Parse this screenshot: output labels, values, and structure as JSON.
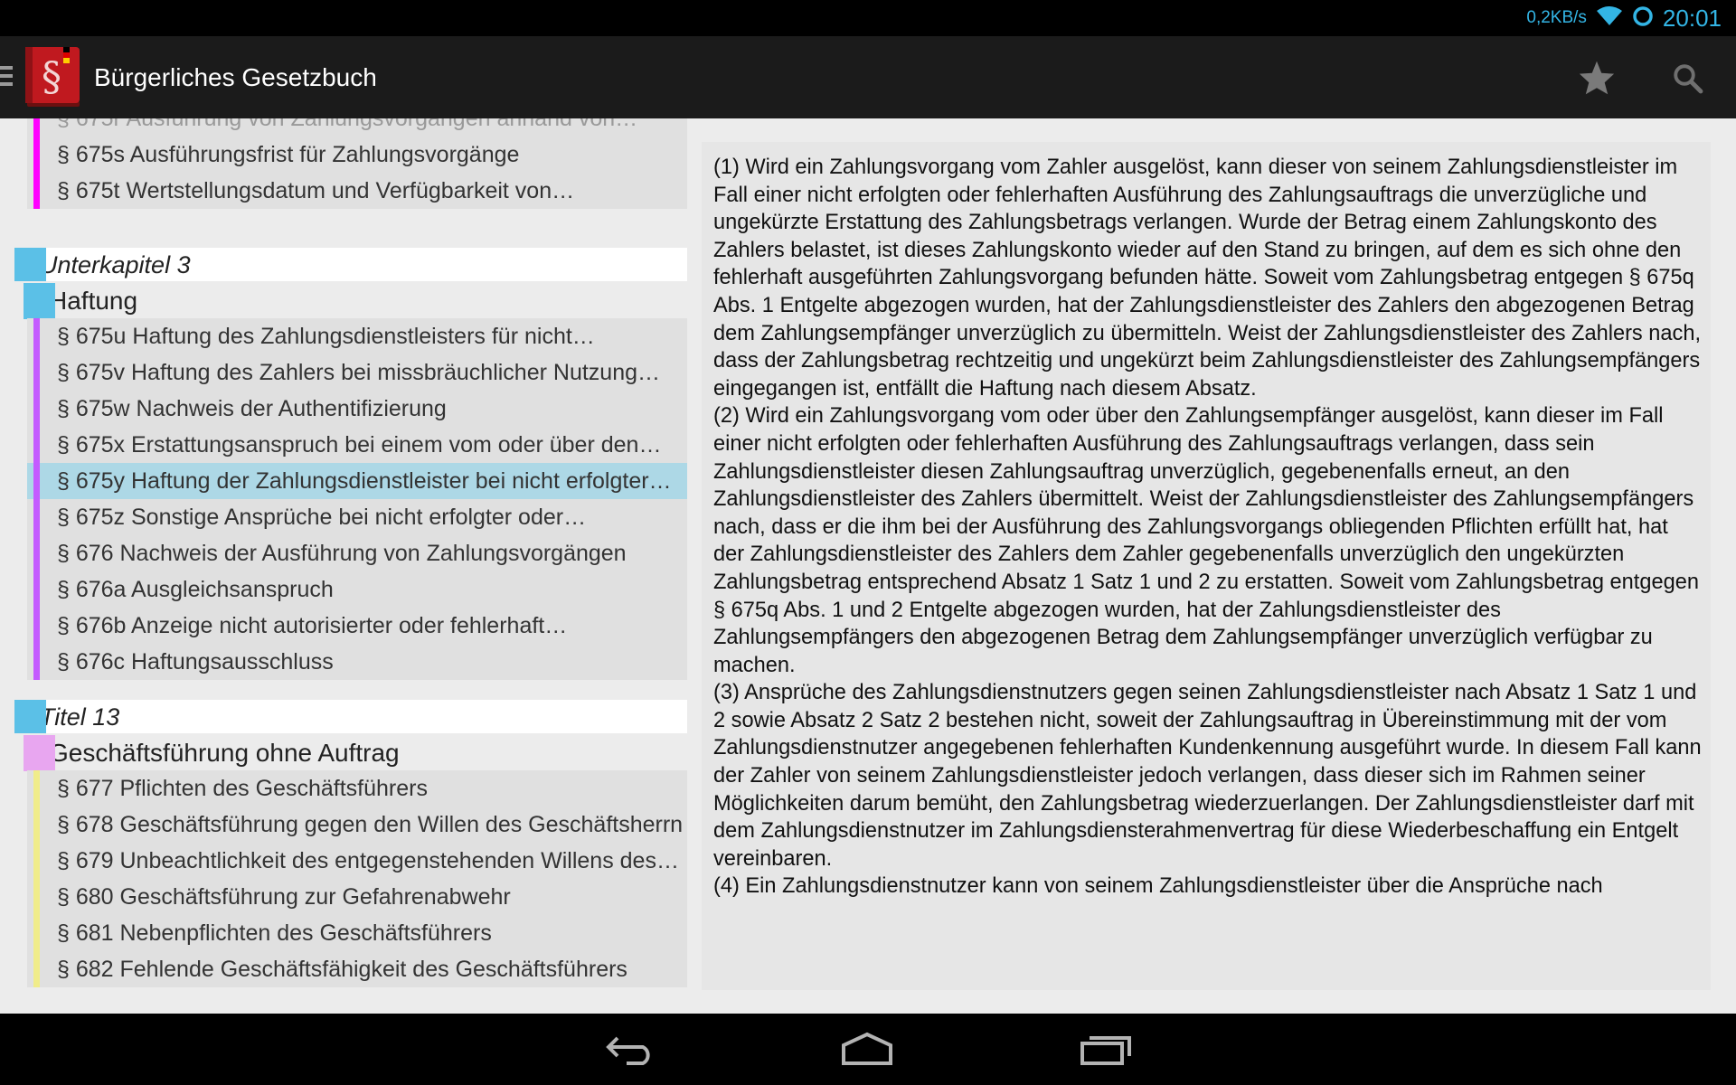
{
  "status_bar": {
    "net_speed": "0,2KB/s",
    "clock": "20:01",
    "accent_color": "#33b5e5",
    "icons": [
      "wifi-icon",
      "sync-icon"
    ]
  },
  "action_bar": {
    "title": "Bürgerliches Gesetzbuch",
    "icons": [
      "drawer-icon",
      "app-icon",
      "star-icon",
      "search-icon"
    ]
  },
  "toc": {
    "top_block": [
      {
        "label": "§ 675s Ausführungsfrist für Zahlungsvorgänge",
        "color": "#ff00ff"
      },
      {
        "label": "§ 675t Wertstellungsdatum und Verfügbarkeit von…",
        "color": "#ff00ff"
      }
    ],
    "group1": {
      "header": "Unterkapitel 3",
      "sub_header": "Haftung",
      "items": [
        {
          "label": "§ 675u Haftung des Zahlungsdienstleisters für nicht…"
        },
        {
          "label": "§ 675v Haftung des Zahlers bei missbräuchlicher Nutzung…"
        },
        {
          "label": "§ 675w Nachweis der Authentifizierung"
        },
        {
          "label": "§ 675x Erstattungsanspruch bei einem vom oder über den…"
        },
        {
          "label": "§ 675y Haftung der Zahlungsdienstleister bei nicht erfolgter…",
          "selected": true
        },
        {
          "label": "§ 675z Sonstige Ansprüche bei nicht erfolgter oder…"
        },
        {
          "label": "§ 676 Nachweis der Ausführung von Zahlungsvorgängen"
        },
        {
          "label": "§ 676a Ausgleichsanspruch"
        },
        {
          "label": "§ 676b Anzeige nicht autorisierter oder fehlerhaft…"
        },
        {
          "label": "§ 676c Haftungsausschluss"
        }
      ],
      "color": "#c45bff"
    },
    "group2": {
      "header": "Titel 13",
      "sub_header": "Geschäftsführung ohne Auftrag",
      "items": [
        {
          "label": "§ 677 Pflichten des Geschäftsführers"
        },
        {
          "label": "§ 678 Geschäftsführung gegen den Willen des Geschäftsherrn"
        },
        {
          "label": "§ 679 Unbeachtlichkeit des entgegenstehenden Willens des…"
        },
        {
          "label": "§ 680 Geschäftsführung zur Gefahrenabwehr"
        },
        {
          "label": "§ 681 Nebenpflichten des Geschäftsführers"
        },
        {
          "label": "§ 682 Fehlende Geschäftsfähigkeit des Geschäftsführers"
        }
      ],
      "color": "#f0ec8a",
      "sub_color": "#e8a6f0"
    },
    "header_bar_color": "#5bc0e7",
    "selected_color": "#add8e6"
  },
  "content": {
    "text": "(1) Wird ein Zahlungsvorgang vom Zahler ausgelöst, kann dieser von seinem Zahlungsdienstleister im Fall einer nicht erfolgten oder fehlerhaften Ausführung des Zahlungsauftrags die unverzügliche und ungekürzte Erstattung des Zahlungsbetrags verlangen. Wurde der Betrag einem Zahlungskonto des Zahlers belastet, ist dieses Zahlungskonto wieder auf den Stand zu bringen, auf dem es sich ohne den fehlerhaft ausgeführten Zahlungsvorgang befunden hätte. Soweit vom Zahlungsbetrag entgegen § 675q Abs. 1 Entgelte abgezogen wurden, hat der Zahlungsdienstleister des Zahlers den abgezogenen Betrag dem Zahlungsempfänger unverzüglich zu übermitteln. Weist der Zahlungsdienstleister des Zahlers nach, dass der Zahlungsbetrag rechtzeitig und ungekürzt beim Zahlungsdienstleister des Zahlungsempfängers eingegangen ist, entfällt die Haftung nach diesem Absatz.\n(2) Wird ein Zahlungsvorgang vom oder über den Zahlungsempfänger ausgelöst, kann dieser im Fall einer nicht erfolgten oder fehlerhaften Ausführung des Zahlungsauftrags verlangen, dass sein Zahlungsdienstleister diesen Zahlungsauftrag unverzüglich, gegebenenfalls erneut, an den Zahlungsdienstleister des Zahlers übermittelt. Weist der Zahlungsdienstleister des Zahlungsempfängers nach, dass er die ihm bei der Ausführung des Zahlungsvorgangs obliegenden Pflichten erfüllt hat, hat der Zahlungsdienstleister des Zahlers dem Zahler gegebenenfalls unverzüglich den ungekürzten Zahlungsbetrag entsprechend Absatz 1 Satz 1 und 2 zu erstatten. Soweit vom Zahlungsbetrag entgegen § 675q Abs. 1 und 2 Entgelte abgezogen wurden, hat der Zahlungsdienstleister des Zahlungsempfängers den abgezogenen Betrag dem Zahlungsempfänger unverzüglich verfügbar zu machen.\n(3) Ansprüche des Zahlungsdienstnutzers gegen seinen Zahlungsdienstleister nach Absatz 1 Satz 1 und 2 sowie Absatz 2 Satz 2 bestehen nicht, soweit der Zahlungsauftrag in Übereinstimmung mit der vom Zahlungsdienstnutzer angegebenen fehlerhaften Kundenkennung ausgeführt wurde. In diesem Fall kann der Zahler von seinem Zahlungsdienstleister jedoch verlangen, dass dieser sich im Rahmen seiner Möglichkeiten darum bemüht, den Zahlungsbetrag wiederzuerlangen. Der Zahlungsdienstleister darf mit dem Zahlungsdienstnutzer im Zahlungsdiensterahmenvertrag für diese Wiederbeschaffung ein Entgelt vereinbaren.\n(4) Ein Zahlungsdienstnutzer kann von seinem Zahlungsdienstleister über die Ansprüche nach"
  },
  "nav_bar": {
    "icons": [
      "back-icon",
      "home-icon",
      "recent-apps-icon"
    ]
  }
}
